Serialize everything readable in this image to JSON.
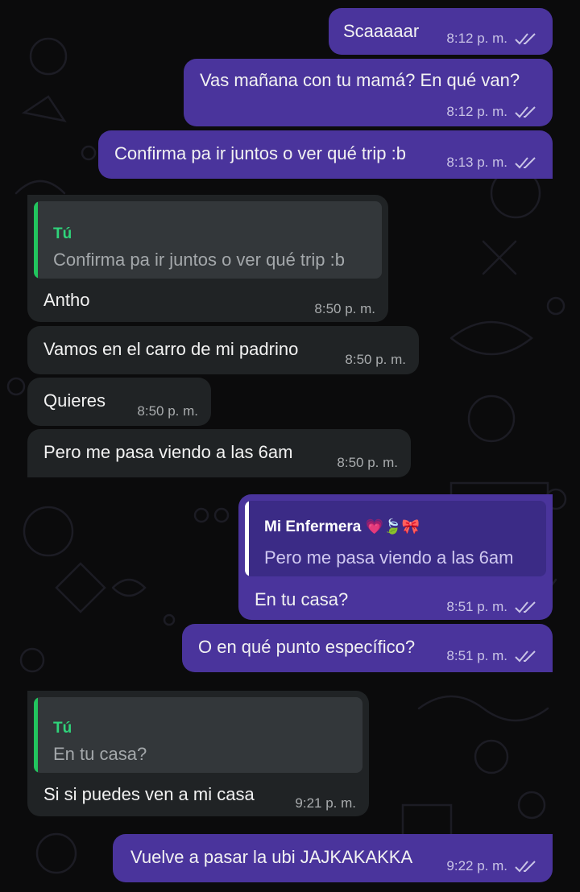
{
  "colors": {
    "outgoing_bubble": "#4a349c",
    "incoming_bubble": "#202325",
    "quote_bar_incoming": "#22c55e",
    "quote_name_incoming": "#2fd37a",
    "background": "#0b0b0c"
  },
  "messages": [
    {
      "text": "Scaaaaar",
      "time": "8:12 p. m."
    },
    {
      "text": "Vas mañana con tu mamá? En qué van?",
      "time": "8:12 p. m."
    },
    {
      "text": "Confirma pa ir juntos o ver qué trip :b",
      "time": "8:13 p. m."
    },
    {
      "quote_name": "Tú",
      "quote_text": "Confirma pa ir juntos o ver qué trip :b",
      "text": "Antho",
      "time": "8:50 p. m."
    },
    {
      "text": "Vamos en el carro de mi padrino",
      "time": "8:50 p. m."
    },
    {
      "text": "Quieres",
      "time": "8:50 p. m."
    },
    {
      "text": "Pero me pasa viendo a las 6am",
      "time": "8:50 p. m."
    },
    {
      "quote_name": "Mi Enfermera",
      "quote_emoji": "💗🍃🎀",
      "quote_text": "Pero me pasa viendo a las 6am",
      "text": "En tu casa?",
      "time": "8:51 p. m."
    },
    {
      "text": "O en qué punto específico?",
      "time": "8:51 p. m."
    },
    {
      "quote_name": "Tú",
      "quote_text": "En tu casa?",
      "text": "Si si puedes ven a mi casa",
      "time": "9:21 p. m."
    },
    {
      "text": "Vuelve a pasar la ubi JAJKAKAKKA",
      "time": "9:22 p. m."
    }
  ],
  "icons": {
    "read_receipt": "double-check-icon"
  }
}
